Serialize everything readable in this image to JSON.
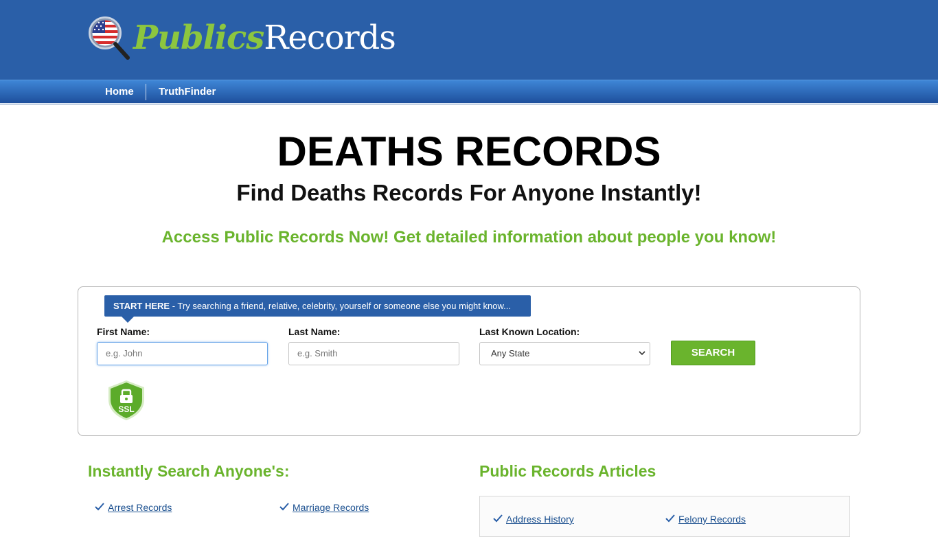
{
  "header": {
    "logo_part1": "Publics",
    "logo_part2": "Records"
  },
  "nav": {
    "items": [
      {
        "label": "Home"
      },
      {
        "label": "TruthFinder"
      }
    ]
  },
  "hero": {
    "title": "DEATHS RECORDS",
    "subtitle": "Find Deaths Records For Anyone Instantly!",
    "tagline": "Access Public Records Now! Get detailed information about people you know!"
  },
  "search": {
    "banner_strong": "START HERE",
    "banner_text": " - Try searching a friend, relative, celebrity, yourself or someone else you might know...",
    "first_name_label": "First Name:",
    "first_name_placeholder": "e.g. John",
    "last_name_label": "Last Name:",
    "last_name_placeholder": "e.g. Smith",
    "location_label": "Last Known Location:",
    "location_value": "Any State",
    "button_label": "SEARCH",
    "ssl_badge": "SSL"
  },
  "instant": {
    "heading": "Instantly Search Anyone's:",
    "links": [
      "Arrest Records",
      "Marriage Records"
    ]
  },
  "articles": {
    "heading": "Public Records Articles",
    "links": [
      "Address History",
      "Felony Records"
    ]
  },
  "colors": {
    "header_blue": "#2a5fa8",
    "accent_green": "#6ab42d",
    "link_blue": "#1a4f8f"
  }
}
